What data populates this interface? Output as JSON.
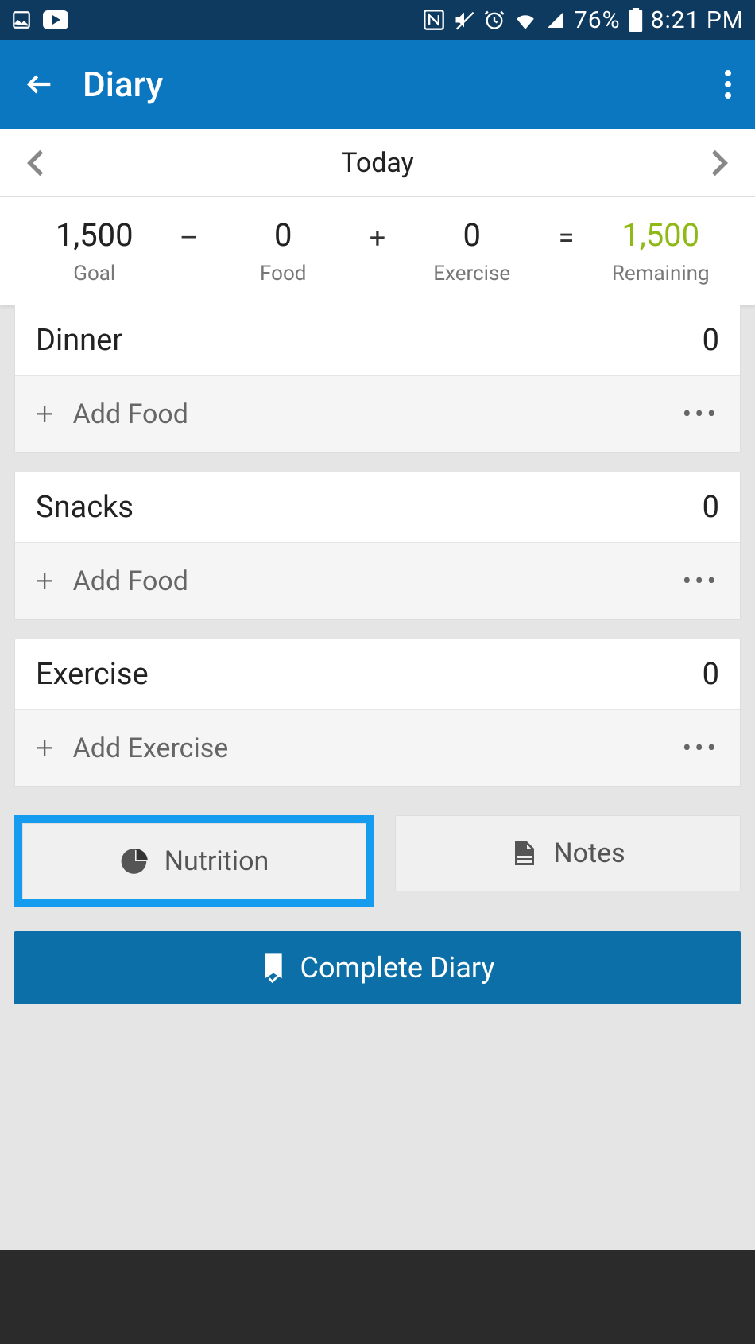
{
  "status": {
    "battery_pct": "76%",
    "time": "8:21 PM"
  },
  "app_bar": {
    "title": "Diary"
  },
  "date_nav": {
    "label": "Today"
  },
  "summary": {
    "goal": {
      "value": "1,500",
      "label": "Goal"
    },
    "food": {
      "value": "0",
      "label": "Food"
    },
    "exercise": {
      "value": "0",
      "label": "Exercise"
    },
    "remaining": {
      "value": "1,500",
      "label": "Remaining"
    },
    "op_minus": "–",
    "op_plus": "+",
    "op_eq": "="
  },
  "meals": [
    {
      "name": "Dinner",
      "calories": "0",
      "action": "Add Food"
    },
    {
      "name": "Snacks",
      "calories": "0",
      "action": "Add Food"
    },
    {
      "name": "Exercise",
      "calories": "0",
      "action": "Add Exercise"
    }
  ],
  "buttons": {
    "nutrition": "Nutrition",
    "notes": "Notes",
    "complete": "Complete Diary"
  }
}
